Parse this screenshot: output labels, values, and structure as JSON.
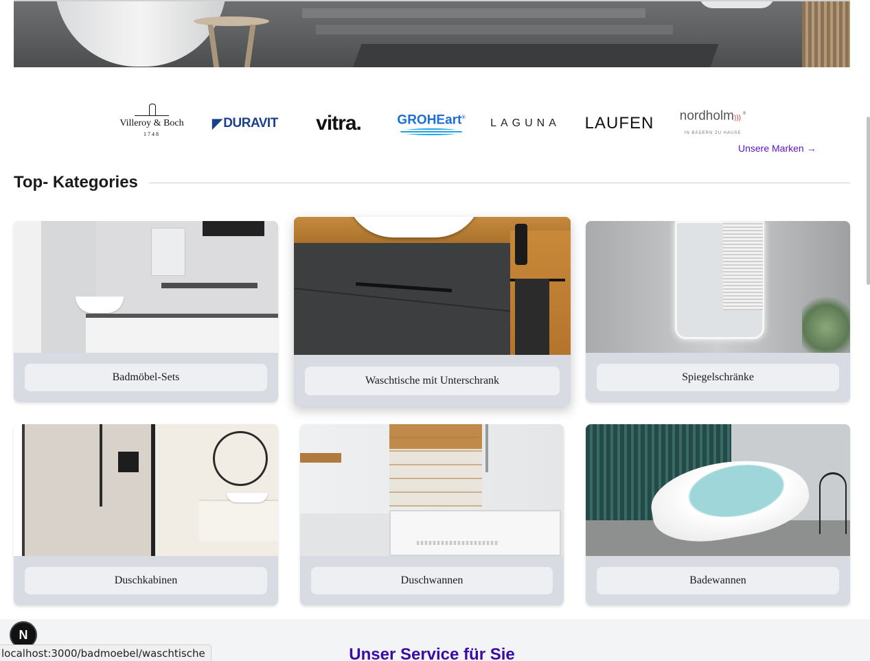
{
  "brands": {
    "items": [
      {
        "name": "Villeroy & Boch",
        "sub": "1748"
      },
      {
        "name": "DURAVIT"
      },
      {
        "name": "vitra."
      },
      {
        "name": "GROHEart",
        "mark": "®"
      },
      {
        "name": "LAGUNA"
      },
      {
        "name": "LAUFEN"
      },
      {
        "name": "nordholm",
        "mark": "®",
        "sub": "IN BÄDERN ZU HAUSE"
      }
    ],
    "more_link": "Unsere Marken →"
  },
  "categories": {
    "title": "Top- Kategories",
    "items": [
      {
        "label": "Badmöbel-Sets"
      },
      {
        "label": "Waschtische mit Unterschrank"
      },
      {
        "label": "Spiegelschränke"
      },
      {
        "label": "Duschkabinen"
      },
      {
        "label": "Duschwannen"
      },
      {
        "label": "Badewannen"
      }
    ]
  },
  "service": {
    "title": "Unser Service für Sie"
  },
  "devtools": {
    "badge": "N"
  },
  "statusbar": {
    "url": "localhost:3000/badmoebel/waschtische"
  }
}
